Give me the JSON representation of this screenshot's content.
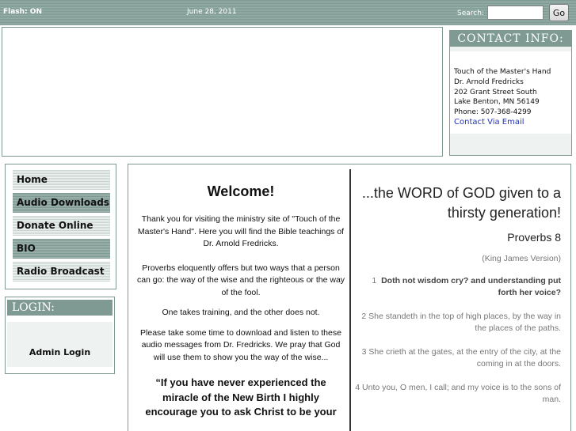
{
  "topbar": {
    "flash_status": "Flash: ON",
    "date": "June 28, 2011",
    "search_label": "Search:",
    "search_value": "",
    "go_label": "Go"
  },
  "contact": {
    "title": "CONTACT INFO:",
    "lines": [
      "Touch of the Master's Hand",
      "Dr. Arnold Fredricks",
      "202 Grant Street South",
      "Lake Benton, MN  56149",
      "Phone: 507-368-4299"
    ],
    "email_link": "Contact Via Email"
  },
  "nav": {
    "items": [
      {
        "label": "Home"
      },
      {
        "label": "Audio Downloads"
      },
      {
        "label": "Donate Online"
      },
      {
        "label": "BIO"
      },
      {
        "label": "Radio Broadcast"
      }
    ]
  },
  "login": {
    "title": "LOGIN:",
    "admin_label": "Admin Login"
  },
  "welcome": {
    "title": "Welcome!",
    "p1": "Thank you for visiting the ministry site of \"Touch of the Master's Hand\". Here you will find the Bible teachings of Dr. Arnold Fredricks.",
    "p2": "Proverbs eloquently offers but two ways that a person can go: the way of the wise and the righteous or the way of the fool.",
    "p3": "One takes training, and the other does not.",
    "p4": "Please take some time to download and listen to these audio messages from Dr. Fredricks.  We pray that God will use them to show you the way of the wise...",
    "quote": "“If you have never experienced the miracle of the New Birth I highly encourage you to ask Christ to be your"
  },
  "scripture": {
    "title": "...the WORD of GOD given to a thirsty generation!",
    "book": "Proverbs 8",
    "version": "(King James Version)",
    "verses": [
      {
        "num": "1",
        "text": "Doth not wisdom cry? and understanding put forth her voice?"
      },
      {
        "num": "2",
        "text": "She standeth in the top of high places, by the way in the places of the paths."
      },
      {
        "num": "3",
        "text": "She crieth at the gates, at the entry of the city, at the coming in at the doors."
      },
      {
        "num": "4",
        "text": "Unto you, O men, I call; and my voice is to the sons of man."
      }
    ]
  },
  "colors": {
    "accent": "#7f9a93",
    "panel_bg": "#eef2f1",
    "link": "#2233bb"
  }
}
